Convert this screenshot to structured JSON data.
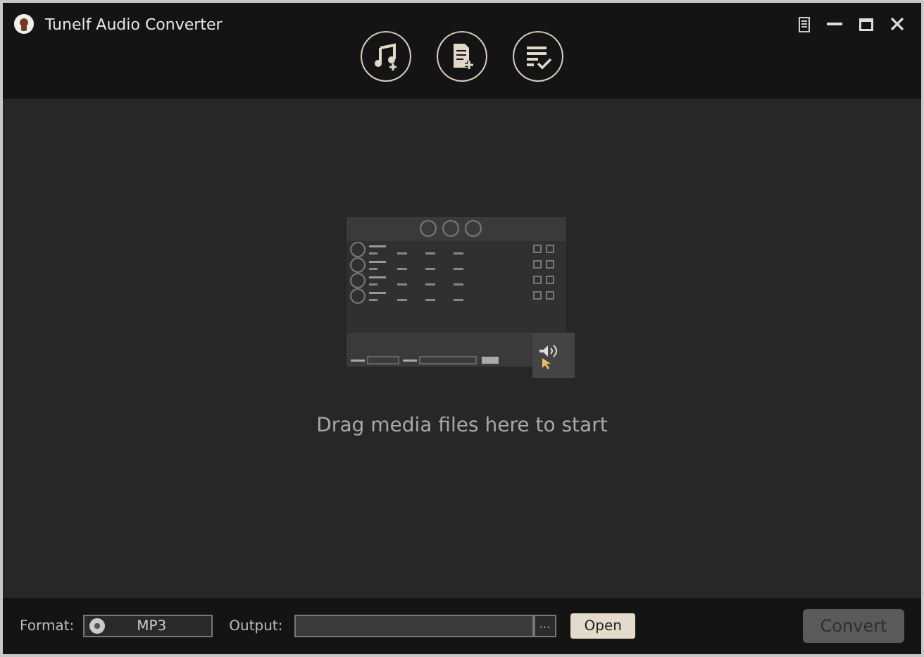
{
  "window": {
    "title": "Tunelf Audio Converter"
  },
  "drop_area": {
    "hint": "Drag media files here to start"
  },
  "bottom_bar": {
    "format_label": "Format:",
    "format_value": "MP3",
    "output_label": "Output:",
    "browse_button": "···",
    "open_button": "Open",
    "convert_button": {
      "label": "Convert",
      "disabled": true
    }
  }
}
